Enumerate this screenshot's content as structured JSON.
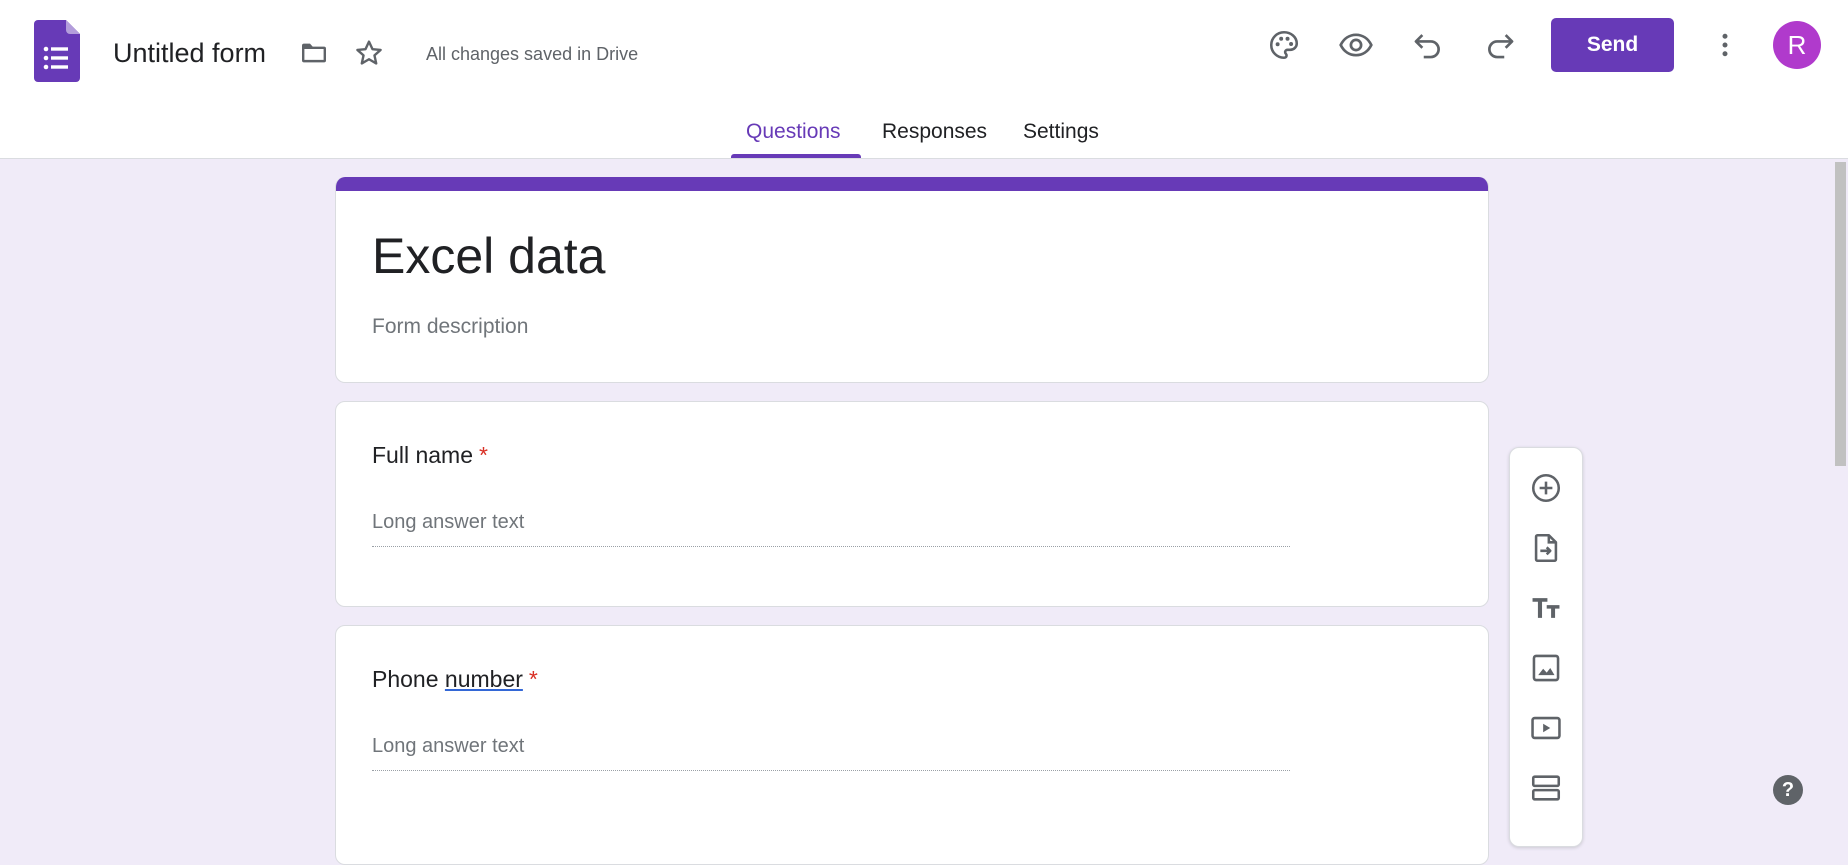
{
  "header": {
    "app_icon": "google-forms-icon",
    "doc_title": "Untitled form",
    "save_status": "All changes saved in Drive",
    "icons": [
      "folder-icon",
      "star-icon",
      "palette-icon",
      "eye-icon",
      "undo-icon",
      "redo-icon",
      "more-vert-icon"
    ],
    "send_label": "Send",
    "avatar_letter": "R",
    "accent_color": "#673ab7"
  },
  "tabs": [
    {
      "label": "Questions",
      "active": true
    },
    {
      "label": "Responses",
      "active": false
    },
    {
      "label": "Settings",
      "active": false
    }
  ],
  "form": {
    "title": "Excel data",
    "description_placeholder": "Form description"
  },
  "questions": [
    {
      "title": "Full name",
      "title_parts": [
        "Full name"
      ],
      "required_mark": "*",
      "answer_placeholder": "Long answer text"
    },
    {
      "title": "Phone number",
      "title_parts": [
        "Phone ",
        "number"
      ],
      "required_mark": "*",
      "answer_placeholder": "Long answer text"
    }
  ],
  "toolbar": {
    "items": [
      "add-question-icon",
      "import-questions-icon",
      "add-title-icon",
      "add-image-icon",
      "add-video-icon",
      "add-section-icon"
    ]
  },
  "help_label": "?",
  "colors": {
    "background": "#f0ebf8",
    "primary": "#673ab7",
    "required": "#d93025",
    "avatar": "#b03acc"
  }
}
